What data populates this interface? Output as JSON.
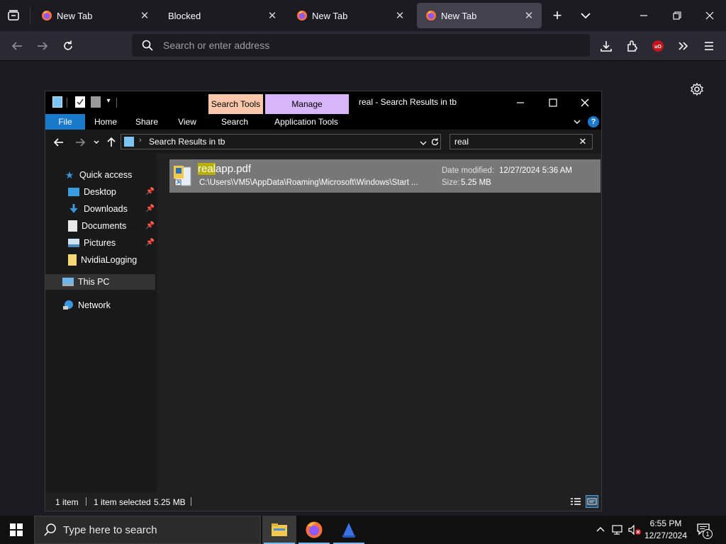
{
  "browser": {
    "tabs": [
      {
        "label": "New Tab",
        "active": false
      },
      {
        "label": "Blocked",
        "active": false
      },
      {
        "label": "New Tab",
        "active": false
      },
      {
        "label": "New Tab",
        "active": true
      }
    ],
    "address_placeholder": "Search or enter address"
  },
  "explorer": {
    "title": "real - Search Results in tb",
    "context_tabs": {
      "search_tools": "Search Tools",
      "manage": "Manage"
    },
    "ribbon_tabs": [
      "File",
      "Home",
      "Share",
      "View",
      "Search",
      "Application Tools"
    ],
    "breadcrumb": "Search Results in tb",
    "search_value": "real",
    "nav": {
      "quick_access": "Quick access",
      "items": [
        "Desktop",
        "Downloads",
        "Documents",
        "Pictures",
        "NvidiaLogging"
      ],
      "this_pc": "This PC",
      "network": "Network"
    },
    "result": {
      "name_highlight": "real",
      "name_rest": "app.pdf",
      "path": "C:\\Users\\VM5\\AppData\\Roaming\\Microsoft\\Windows\\Start ...",
      "date_label": "Date modified:",
      "date_value": "12/27/2024 5:36 AM",
      "size_label": "Size:",
      "size_value": "5.25 MB"
    },
    "status": {
      "count": "1 item",
      "selected": "1 item selected",
      "size": "5.25 MB"
    }
  },
  "taskbar": {
    "search_placeholder": "Type here to search",
    "time": "6:55 PM",
    "date": "12/27/2024",
    "notification_count": "1"
  },
  "colors": {
    "search_tools_tab": "#f9c8a8",
    "manage_tab": "#d8b4f8",
    "file_tab": "#1979ca",
    "selection": "#777777",
    "highlight": "#b8b000"
  }
}
